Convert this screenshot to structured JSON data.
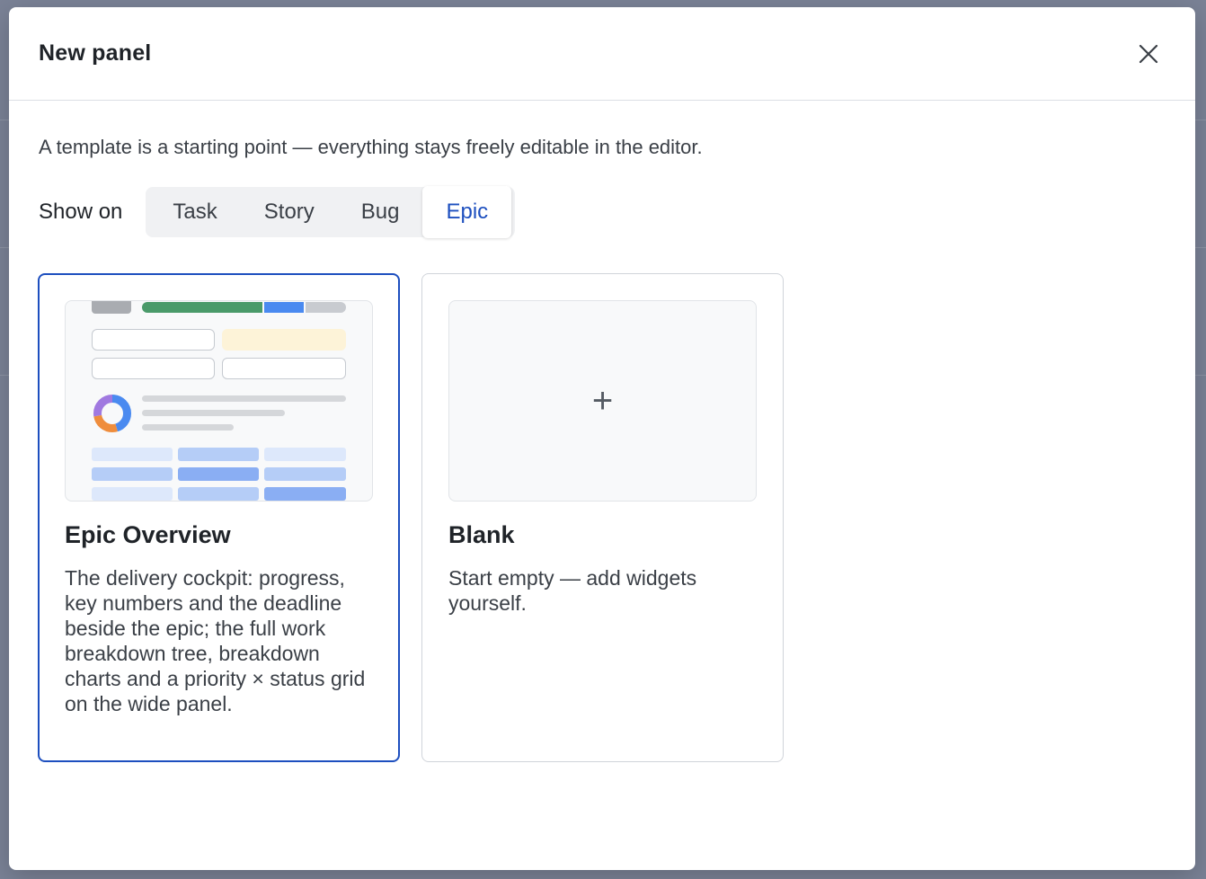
{
  "modal": {
    "title": "New panel",
    "close_icon": "close-icon",
    "description": "A template is a starting point — everything stays freely editable in the editor."
  },
  "show_on": {
    "label": "Show on",
    "options": [
      "Task",
      "Story",
      "Bug",
      "Epic"
    ],
    "selected": "Epic"
  },
  "templates": [
    {
      "title": "Epic Overview",
      "description": "The delivery cockpit: progress, key numbers and the deadline beside the epic; the full work breakdown tree, breakdown charts and a priority × status grid on the wide panel.",
      "selected": true,
      "preview_icon": "dashboard-preview"
    },
    {
      "title": "Blank",
      "description": "Start empty — add widgets yourself.",
      "selected": false,
      "preview_icon": "plus-icon",
      "preview_glyph": "+"
    }
  ],
  "colors": {
    "accent": "#1d4fbf",
    "progress_done": "#4a9a6a",
    "progress_active": "#4a8af0",
    "progress_remaining": "#c8cbd0",
    "highlight_tile": "#fdf3d8",
    "heat_light": "#dde8fb",
    "heat_mid": "#b5cdf7",
    "heat_strong": "#8aaef3"
  }
}
